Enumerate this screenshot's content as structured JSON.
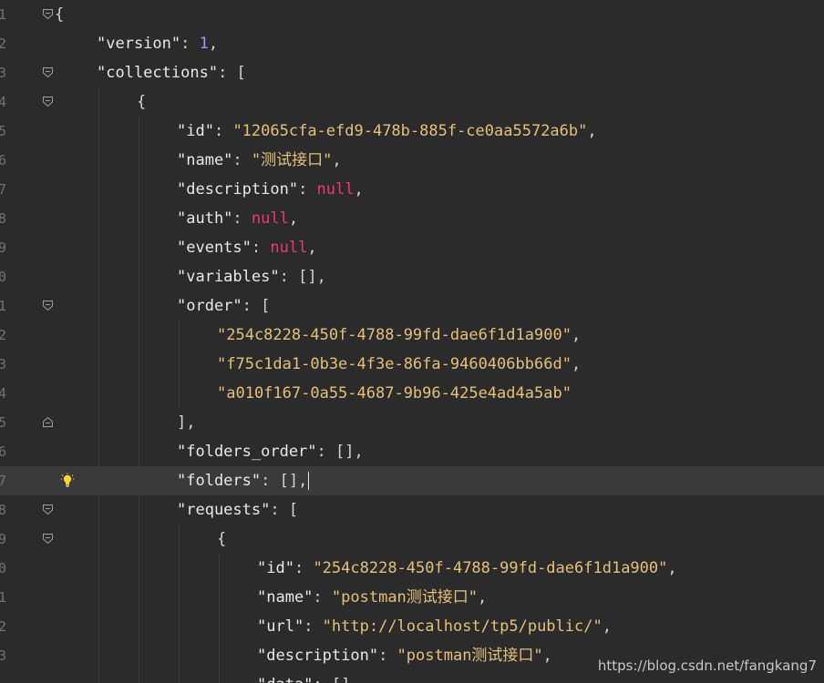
{
  "gutter": {
    "line_numbers": [
      "1",
      "2",
      "3",
      "4",
      "5",
      "6",
      "7",
      "8",
      "9",
      "0",
      "1",
      "2",
      "3",
      "4",
      "5",
      "6",
      "7",
      "8",
      "9",
      "0",
      "1",
      "2",
      "3"
    ]
  },
  "code": {
    "l1": "{",
    "l2_key": "\"version\"",
    "l2_val": "1",
    "l3_key": "\"collections\"",
    "l3_val": "[",
    "l4": "{",
    "l5_key": "\"id\"",
    "l5_val": "\"12065cfa-efd9-478b-885f-ce0aa5572a6b\"",
    "l6_key": "\"name\"",
    "l6_val": "\"测试接口\"",
    "l7_key": "\"description\"",
    "l7_val": "null",
    "l8_key": "\"auth\"",
    "l8_val": "null",
    "l9_key": "\"events\"",
    "l9_val": "null",
    "l10_key": "\"variables\"",
    "l10_val": "[]",
    "l11_key": "\"order\"",
    "l11_val": "[",
    "l12_val": "\"254c8228-450f-4788-99fd-dae6f1d1a900\"",
    "l13_val": "\"f75c1da1-0b3e-4f3e-86fa-9460406bb66d\"",
    "l14_val": "\"a010f167-0a55-4687-9b96-425e4ad4a5ab\"",
    "l15": "],",
    "l16_key": "\"folders_order\"",
    "l16_val": "[]",
    "l17_key": "\"folders\"",
    "l17_val": "[]",
    "l18_key": "\"requests\"",
    "l18_val": "[",
    "l19": "{",
    "l20_key": "\"id\"",
    "l20_val": "\"254c8228-450f-4788-99fd-dae6f1d1a900\"",
    "l21_key": "\"name\"",
    "l21_val": "\"postman测试接口\"",
    "l22_key": "\"url\"",
    "l22_val": "\"http://localhost/tp5/public/\"",
    "l23_key": "\"description\"",
    "l23_val": "\"postman测试接口\"",
    "l24_key": "\"data\"",
    "l24_val": "[]"
  },
  "watermark": "https://blog.csdn.net/fangkang7",
  "colors": {
    "background": "#2b2b2b",
    "current_line": "#3a3a3a",
    "key": "#e8e8e8",
    "string": "#e6c07b",
    "number": "#b38ff0",
    "null": "#f0386b"
  },
  "icons": [
    "fold-open-icon",
    "fold-close-icon",
    "lightbulb-icon"
  ]
}
